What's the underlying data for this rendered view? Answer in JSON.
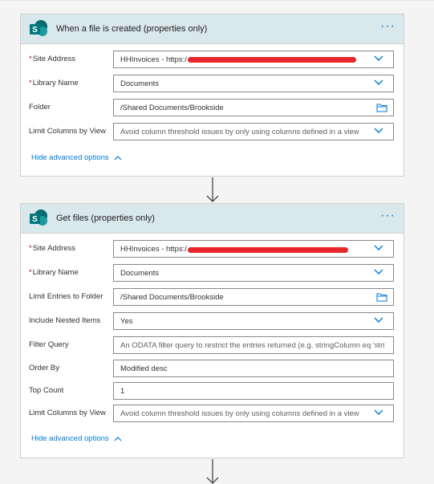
{
  "colors": {
    "accent": "#0078d4",
    "header_bg": "#d9e8ea",
    "required": "#a4262c",
    "redaction": "#e8262b",
    "sharepoint": "#036c70"
  },
  "card1": {
    "icon": "sharepoint-icon",
    "icon_letter": "S",
    "title": "When a file is created (properties only)",
    "more": "···",
    "fields": [
      {
        "label": "Site Address",
        "required": "*",
        "value": "HHInvoices - https:/",
        "control": "dropdown"
      },
      {
        "label": "Library Name",
        "required": "*",
        "value": "Documents",
        "control": "dropdown"
      },
      {
        "label": "Folder",
        "required": "",
        "value": "/Shared Documents/Brookside",
        "control": "folder"
      },
      {
        "label": "Limit Columns by View",
        "required": "",
        "value": "Avoid column threshold issues by only using columns defined in a view",
        "control": "dropdown"
      }
    ],
    "advanced": "Hide advanced options"
  },
  "card2": {
    "icon": "sharepoint-icon",
    "icon_letter": "S",
    "title": "Get files (properties only)",
    "more": "···",
    "fields": [
      {
        "label": "Site Address",
        "required": "*",
        "value": "HHInvoices - https:/",
        "control": "dropdown"
      },
      {
        "label": "Library Name",
        "required": "*",
        "value": "Documents",
        "control": "dropdown"
      },
      {
        "label": "Limit Entries to Folder",
        "required": "",
        "value": "/Shared Documents/Brookside",
        "control": "folder"
      },
      {
        "label": "Include Nested Items",
        "required": "",
        "value": "Yes",
        "control": "dropdown"
      },
      {
        "label": "Filter Query",
        "required": "",
        "value": "An ODATA filter query to restrict the entries returned (e.g. stringColumn eq 'stri",
        "control": "text"
      },
      {
        "label": "Order By",
        "required": "",
        "value": "Modified desc",
        "control": "text"
      },
      {
        "label": "Top Count",
        "required": "",
        "value": "1",
        "control": "text"
      },
      {
        "label": "Limit Columns by View",
        "required": "",
        "value": "Avoid column threshold issues by only using columns defined in a view",
        "control": "dropdown"
      }
    ],
    "advanced": "Hide advanced options"
  }
}
